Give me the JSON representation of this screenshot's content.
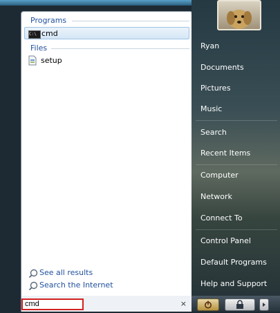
{
  "results": {
    "programs_header": "Programs",
    "programs": [
      {
        "label": "cmd",
        "icon": "cmd-icon"
      }
    ],
    "files_header": "Files",
    "files": [
      {
        "label": "setup",
        "icon": "setup-file-icon"
      }
    ]
  },
  "links": {
    "see_all": "See all results",
    "search_internet": "Search the Internet"
  },
  "search": {
    "value": "cmd",
    "clear_glyph": "×"
  },
  "right_menu": {
    "items": [
      "Ryan",
      "Documents",
      "Pictures",
      "Music",
      "Search",
      "Recent Items",
      "Computer",
      "Network",
      "Connect To",
      "Control Panel",
      "Default Programs",
      "Help and Support"
    ]
  },
  "colors": {
    "header_blue": "#1f4f9c",
    "search_highlight": "#d42020"
  }
}
